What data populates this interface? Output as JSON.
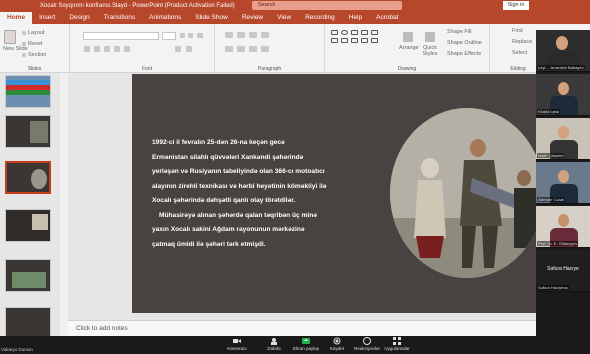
{
  "window": {
    "title": "Xocalı Soyqırımı konfransı.Slayd - PowerPoint (Product Activation Failed)",
    "search_placeholder": "Search",
    "sign_in": "Sign in"
  },
  "tabs": [
    "Home",
    "Insert",
    "Design",
    "Transitions",
    "Animations",
    "Slide Show",
    "Review",
    "View",
    "Recording",
    "Help",
    "Acrobat"
  ],
  "ribbon": {
    "new_slide": "New Slide",
    "layout": "Layout",
    "reset": "Reset",
    "section": "Section",
    "arrange": "Arrange",
    "quick_styles": "Quick Styles",
    "shape_fill": "Shape Fill",
    "shape_outline": "Shape Outline",
    "shape_effects": "Shape Effects",
    "find": "Find",
    "replace": "Replace",
    "select": "Select",
    "groups": {
      "slides": "Slides",
      "font": "Font",
      "paragraph": "Paragraph",
      "drawing": "Drawing",
      "editing": "Editing"
    }
  },
  "slide": {
    "lines": [
      "1992-ci il fevralın 25-dən 26-na keçən gecə",
      "Ermənistan silahlı qüvvələri Xankəndi şəhərində",
      "yerləşən və Rusiyanın tabeliyində olan 366-cı motoatıcı",
      "alayının zirehli texnikası və hərbi heyətinin köməkliyi ilə",
      "Xocalı şəhərində dəhşətli qanlı olay törətdilər.",
      "Mühasirəyə alınan şəhərdə qalan təqribən üç minə",
      "yaxın Xocalı sakini Ağdam rayonunun mərkəzinə",
      "çatmaq ümidi ilə şəhəri tərk etmişdi."
    ]
  },
  "notes_placeholder": "Click to add notes",
  "participants": [
    {
      "name": "Leyl... Jevanshir Babayev"
    },
    {
      "name": "Khalid Iqbal"
    },
    {
      "name": "Nadir Qhazimi"
    },
    {
      "name": "Allender Cələb"
    },
    {
      "name": "Prof. Dr. E. Gülseyyev"
    },
    {
      "name": "Səfura Hacıyeva",
      "caption": "Səfura Hacıye"
    }
  ],
  "zoom_bar": {
    "left_label": "Vidoeyu Dursun",
    "items": [
      "Kameranı",
      "Dəbdə",
      "Ekran paylaş",
      "Kaydet",
      "Reaksiyonlar",
      "Uygulamalar"
    ]
  },
  "colors": {
    "brand": "#b7472a",
    "slide_bg": "#484340"
  }
}
